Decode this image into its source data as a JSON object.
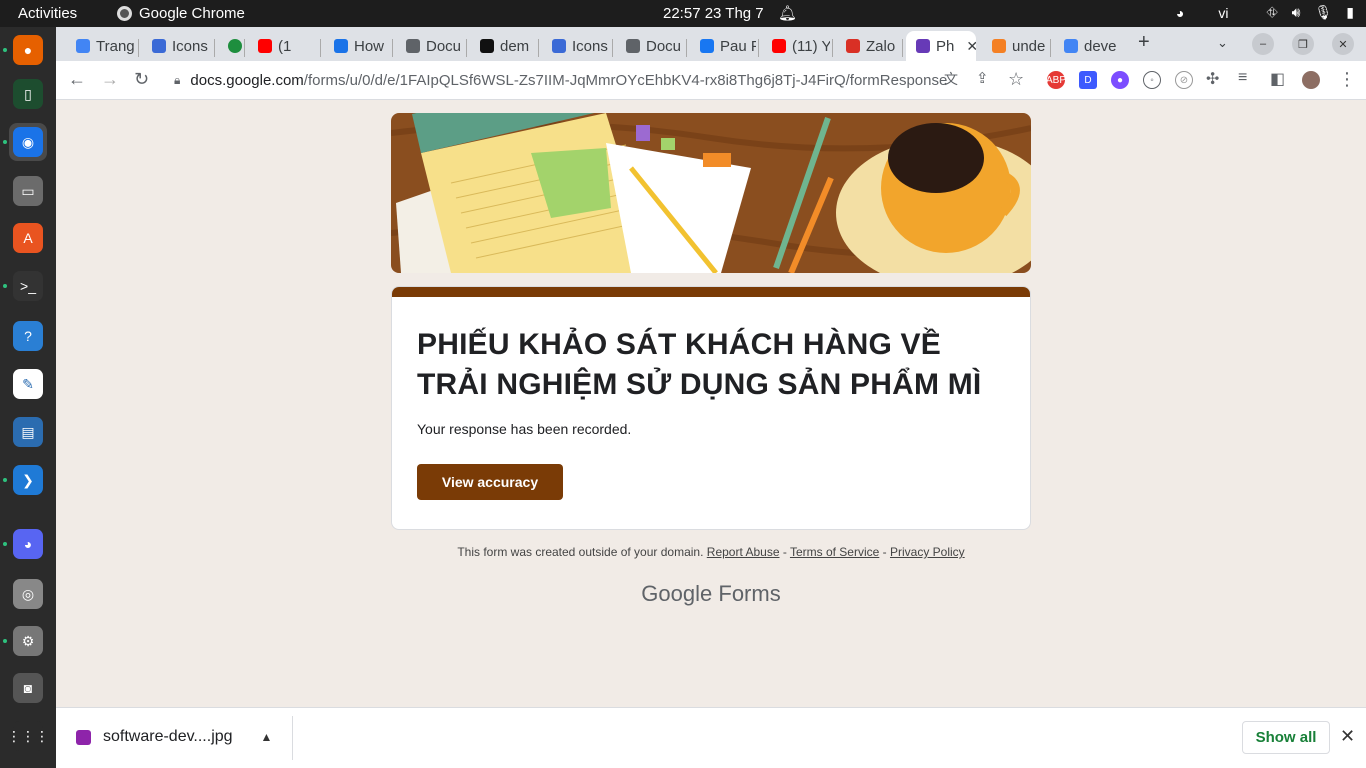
{
  "topbar": {
    "activities": "Activities",
    "app_name": "Google Chrome",
    "clock": "22:57  23 Thg 7",
    "language": "vi"
  },
  "tabs": [
    {
      "label": "Trang",
      "color": "#4285f4"
    },
    {
      "label": "Icons",
      "color": "#3b6ad6"
    },
    {
      "label": "",
      "color": "#1e8e3e"
    },
    {
      "label": "(1",
      "color": "#ff0000"
    },
    {
      "label": "How",
      "color": "#1a73e8"
    },
    {
      "label": "Docu",
      "color": "#5f6368"
    },
    {
      "label": "dem",
      "color": "#111111"
    },
    {
      "label": "Icons",
      "color": "#3b6ad6"
    },
    {
      "label": "Docu",
      "color": "#5f6368"
    },
    {
      "label": "Pau F",
      "color": "#1877f2"
    },
    {
      "label": "(11) Y",
      "color": "#ff0000"
    },
    {
      "label": "Zalo",
      "color": "#d93025"
    },
    {
      "label": "Ph",
      "color": "#673ab7",
      "active": true
    },
    {
      "label": "unde",
      "color": "#f48024"
    },
    {
      "label": "deve",
      "color": "#4285f4"
    }
  ],
  "omnibox": {
    "host": "docs.google.com",
    "path": "/forms/u/0/d/e/1FAIpQLSf6WSL-Zs7IIM-JqMmrOYcEhbKV4-rx8i8Thg6j8Tj-J4FirQ/formResponse"
  },
  "form": {
    "title": "PHIẾU KHẢO SÁT KHÁCH HÀNG VỀ TRẢI NGHIỆM SỬ DỤNG SẢN PHẨM MÌ",
    "message": "Your response has been recorded.",
    "button": "View accuracy",
    "theme_color": "#7a3b06"
  },
  "footer": {
    "text": "This form was created outside of your domain.",
    "report": "Report Abuse",
    "terms": "Terms of Service",
    "privacy": "Privacy Policy",
    "sep": " - ",
    "google": "Google",
    "forms": "Forms"
  },
  "download": {
    "filename": "software-dev....jpg",
    "show_all": "Show all"
  },
  "dock": [
    {
      "name": "firefox-icon",
      "color": "#e66000",
      "glyph": "●"
    },
    {
      "name": "terminal-app-icon",
      "color": "#1d4d2f",
      "glyph": "▯"
    },
    {
      "name": "chrome-icon",
      "color": "#1a73e8",
      "glyph": "◉",
      "active": true
    },
    {
      "name": "files-icon",
      "color": "#6b6b6b",
      "glyph": "▭"
    },
    {
      "name": "software-center-icon",
      "color": "#e95420",
      "glyph": "A"
    },
    {
      "name": "terminal-icon",
      "color": "#333333",
      "glyph": ">_"
    },
    {
      "name": "help-icon",
      "color": "#2a7fd4",
      "glyph": "?"
    },
    {
      "name": "text-editor-icon",
      "color": "#ffffff",
      "glyph": "✎"
    },
    {
      "name": "writer-icon",
      "color": "#2b6cb0",
      "glyph": "▤"
    },
    {
      "name": "vscode-icon",
      "color": "#1f7ad6",
      "glyph": "❯"
    },
    {
      "name": "discord-icon",
      "color": "#5865f2",
      "glyph": "◕"
    },
    {
      "name": "disk-icon",
      "color": "#888888",
      "glyph": "◎"
    },
    {
      "name": "settings-icon",
      "color": "#777777",
      "glyph": "⚙"
    },
    {
      "name": "screenshot-icon",
      "color": "#555555",
      "glyph": "◙"
    },
    {
      "name": "show-apps-icon",
      "color": "#2b2b2b",
      "glyph": "⋮⋮⋮"
    }
  ]
}
